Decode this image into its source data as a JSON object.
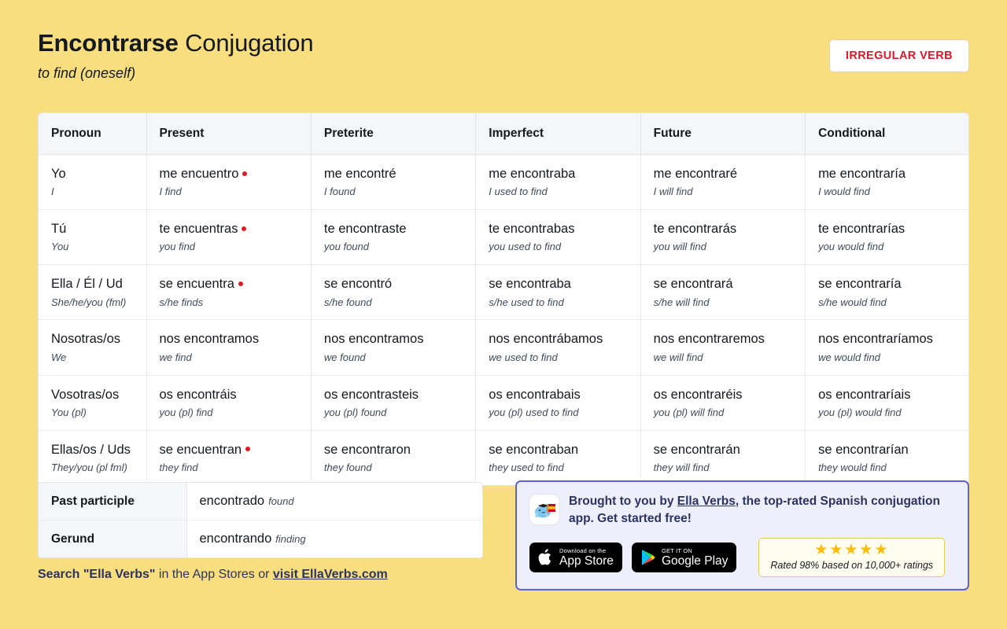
{
  "header": {
    "verb": "Encontrarse",
    "title_suffix": " Conjugation",
    "subtitle": "to find (oneself)",
    "badge": "IRREGULAR VERB",
    "badge_color": "#d7192c"
  },
  "table": {
    "columns": [
      "Pronoun",
      "Present",
      "Preterite",
      "Imperfect",
      "Future",
      "Conditional"
    ],
    "rows": [
      {
        "pronoun": "Yo",
        "pronoun_gloss": "I",
        "cells": [
          {
            "form": "me encuentro",
            "gloss": "I find",
            "irregular": true
          },
          {
            "form": "me encontré",
            "gloss": "I found",
            "irregular": false
          },
          {
            "form": "me encontraba",
            "gloss": "I used to find",
            "irregular": false
          },
          {
            "form": "me encontraré",
            "gloss": "I will find",
            "irregular": false
          },
          {
            "form": "me encontraría",
            "gloss": "I would find",
            "irregular": false
          }
        ]
      },
      {
        "pronoun": "Tú",
        "pronoun_gloss": "You",
        "cells": [
          {
            "form": "te encuentras",
            "gloss": "you find",
            "irregular": true
          },
          {
            "form": "te encontraste",
            "gloss": "you found",
            "irregular": false
          },
          {
            "form": "te encontrabas",
            "gloss": "you used to find",
            "irregular": false
          },
          {
            "form": "te encontrarás",
            "gloss": "you will find",
            "irregular": false
          },
          {
            "form": "te encontrarías",
            "gloss": "you would find",
            "irregular": false
          }
        ]
      },
      {
        "pronoun": "Ella / Él / Ud",
        "pronoun_gloss": "She/he/you (fml)",
        "cells": [
          {
            "form": "se encuentra",
            "gloss": "s/he finds",
            "irregular": true
          },
          {
            "form": "se encontró",
            "gloss": "s/he found",
            "irregular": false
          },
          {
            "form": "se encontraba",
            "gloss": "s/he used to find",
            "irregular": false
          },
          {
            "form": "se encontrará",
            "gloss": "s/he will find",
            "irregular": false
          },
          {
            "form": "se encontraría",
            "gloss": "s/he would find",
            "irregular": false
          }
        ]
      },
      {
        "pronoun": "Nosotras/os",
        "pronoun_gloss": "We",
        "cells": [
          {
            "form": "nos encontramos",
            "gloss": "we find",
            "irregular": false
          },
          {
            "form": "nos encontramos",
            "gloss": "we found",
            "irregular": false
          },
          {
            "form": "nos encontrábamos",
            "gloss": "we used to find",
            "irregular": false
          },
          {
            "form": "nos encontraremos",
            "gloss": "we will find",
            "irregular": false
          },
          {
            "form": "nos encontraríamos",
            "gloss": "we would find",
            "irregular": false
          }
        ]
      },
      {
        "pronoun": "Vosotras/os",
        "pronoun_gloss": "You (pl)",
        "cells": [
          {
            "form": "os encontráis",
            "gloss": "you (pl) find",
            "irregular": false
          },
          {
            "form": "os encontrasteis",
            "gloss": "you (pl) found",
            "irregular": false
          },
          {
            "form": "os encontrabais",
            "gloss": "you (pl) used to find",
            "irregular": false
          },
          {
            "form": "os encontraréis",
            "gloss": "you (pl) will find",
            "irregular": false
          },
          {
            "form": "os encontraríais",
            "gloss": "you (pl) would find",
            "irregular": false
          }
        ]
      },
      {
        "pronoun": "Ellas/os / Uds",
        "pronoun_gloss": "They/you (pl fml)",
        "cells": [
          {
            "form": "se encuentran",
            "gloss": "they find",
            "irregular": true
          },
          {
            "form": "se encontraron",
            "gloss": "they found",
            "irregular": false
          },
          {
            "form": "se encontraban",
            "gloss": "they used to find",
            "irregular": false
          },
          {
            "form": "se encontrarán",
            "gloss": "they will find",
            "irregular": false
          },
          {
            "form": "se encontrarían",
            "gloss": "they would find",
            "irregular": false
          }
        ]
      }
    ]
  },
  "extra": {
    "rows": [
      {
        "label": "Past participle",
        "form": "encontrado",
        "gloss": "found"
      },
      {
        "label": "Gerund",
        "form": "encontrando",
        "gloss": "finding"
      }
    ]
  },
  "search_line": {
    "bold_prefix": "Search \"Ella Verbs\"",
    "middle": " in the App Stores or ",
    "link": "visit EllaVerbs.com"
  },
  "promo": {
    "icon_name": "ella-verbs-app-icon",
    "text_before_link": "Brought to you by ",
    "link": "Ella Verbs",
    "text_after_link": ", the top-rated Spanish conjugation app. Get started free!",
    "app_store": {
      "small": "Download on the",
      "big": "App Store",
      "icon": "apple-icon"
    },
    "google_play": {
      "small": "GET IT ON",
      "big": "Google Play",
      "icon": "google-play-icon"
    },
    "rating": {
      "stars": "★★★★★",
      "text": "Rated 98% based on 10,000+ ratings",
      "star_color": "#fbbc05"
    }
  }
}
